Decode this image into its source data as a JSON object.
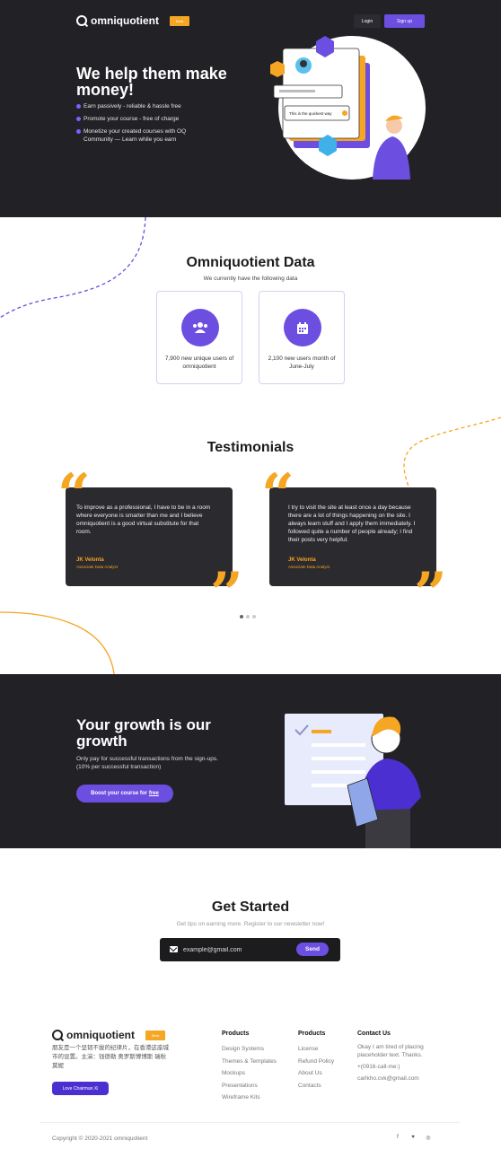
{
  "brand": {
    "name": "omniquotient",
    "badge": "Beta"
  },
  "nav": {
    "login": "Login",
    "signup": "Sign up"
  },
  "hero": {
    "title": "We help them make money!",
    "bullets": [
      "Earn passively - reliable & hassle free",
      "Promote your course - free of charge",
      "Monetize your created courses with OQ Community — Learn while you earn"
    ],
    "bubble_text": "This is the quickest way"
  },
  "data_section": {
    "title": "Omniquotient Data",
    "subtitle": "We currently have the following data",
    "stats": [
      {
        "icon": "users-icon",
        "text": "7,900 new unique users of omniquotient"
      },
      {
        "icon": "calendar-icon",
        "text": "2,100 new users month of June-July"
      }
    ]
  },
  "testimonials": {
    "title": "Testimonials",
    "items": [
      {
        "quote": "To improve as a professional, I have to be in a room where everyone is smarter than me and I believe omniquotient is a good virtual substitute for that room.",
        "name": "JK Velonta",
        "role": "Associate Data Analyst"
      },
      {
        "quote": "I try to visit the site at least once a day because there are a lot of things happening on the site. I always learn stuff and I apply them immediately. I followed quite a number of people already; I find their posts very helpful.",
        "name": "JK Velonta",
        "role": "Associate Data Analyst"
      }
    ],
    "active_dot": 0
  },
  "growth": {
    "title": "Your growth is our growth",
    "subtitle": "Only pay for successful transactions from the sign-ups. (10% per successful transaction)",
    "button_prefix": "Boost your course for",
    "button_free": "free"
  },
  "get_started": {
    "title": "Get Started",
    "subtitle": "Get tips on earning more. Register to our newsletter now!",
    "email_value": "example@gmail.com",
    "send": "Send"
  },
  "footer": {
    "description": "朋友是一个坚韧不拔的纪律片，在香港这座城市的设置。主演：钱德勒 奥罗斯博博斯 瑞秋 莫妮",
    "button": "Love Chairman Xi",
    "col1": {
      "title": "Products",
      "links": [
        "Design Systems",
        "Themes & Templates",
        "Mockups",
        "Presentations",
        "Wireframe Kits"
      ]
    },
    "col2": {
      "title": "Products",
      "links": [
        "License",
        "Refund Policy",
        "About Us",
        "Contacts"
      ]
    },
    "contact": {
      "title": "Contact Us",
      "lines": [
        "Okay I am tired of placing placeholder text. Thanks.",
        "+(0916-call-me:)",
        "carlkho.cvk@gmail.com"
      ]
    },
    "copyright": "Copyright © 2020-2021 omniquotient",
    "socials": [
      "facebook-icon",
      "twitter-icon",
      "instagram-icon"
    ]
  },
  "colors": {
    "accent": "#6c4ee0",
    "orange": "#f5a623",
    "dark": "#222126"
  }
}
